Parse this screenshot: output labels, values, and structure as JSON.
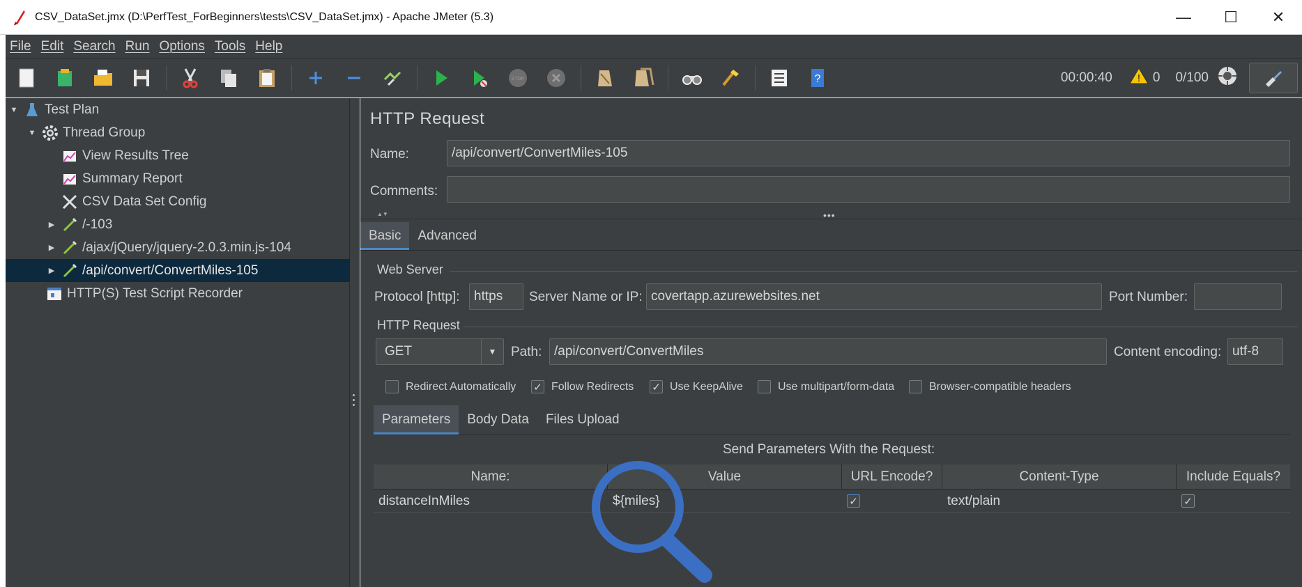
{
  "window": {
    "title": "CSV_DataSet.jmx (D:\\PerfTest_ForBeginners\\tests\\CSV_DataSet.jmx) - Apache JMeter (5.3)",
    "minimize": "—",
    "maximize": "☐",
    "close": "✕"
  },
  "menu": [
    "File",
    "Edit",
    "Search",
    "Run",
    "Options",
    "Tools",
    "Help"
  ],
  "toolbar": {
    "timer": "00:00:40",
    "warnings": "0",
    "threads": "0/100"
  },
  "tree": [
    {
      "label": "Test Plan",
      "icon": "flask-icon"
    },
    {
      "label": "Thread Group",
      "icon": "gear-icon"
    },
    {
      "label": "View Results Tree",
      "icon": "graph-icon"
    },
    {
      "label": "Summary Report",
      "icon": "graph-icon"
    },
    {
      "label": "CSV Data Set Config",
      "icon": "tools-icon"
    },
    {
      "label": "/-103",
      "icon": "pipette-icon"
    },
    {
      "label": "/ajax/jQuery/jquery-2.0.3.min.js-104",
      "icon": "pipette-icon"
    },
    {
      "label": "/api/convert/ConvertMiles-105",
      "icon": "pipette-icon"
    },
    {
      "label": "HTTP(S) Test Script Recorder",
      "icon": "recorder-icon"
    }
  ],
  "panel": {
    "title": "HTTP Request",
    "name_label": "Name:",
    "name_value": "/api/convert/ConvertMiles-105",
    "comments_label": "Comments:",
    "comments_value": "",
    "tabs": [
      "Basic",
      "Advanced"
    ],
    "web_server": {
      "legend": "Web Server",
      "protocol_label": "Protocol [http]:",
      "protocol_value": "https",
      "server_label": "Server Name or IP:",
      "server_value": "covertapp.azurewebsites.net",
      "port_label": "Port Number:",
      "port_value": ""
    },
    "http_request": {
      "legend": "HTTP Request",
      "method": "GET",
      "path_label": "Path:",
      "path_value": "/api/convert/ConvertMiles",
      "encoding_label": "Content encoding:",
      "encoding_value": "utf-8"
    },
    "options": [
      {
        "label": "Redirect Automatically",
        "checked": false
      },
      {
        "label": "Follow Redirects",
        "checked": true
      },
      {
        "label": "Use KeepAlive",
        "checked": true
      },
      {
        "label": "Use multipart/form-data",
        "checked": false
      },
      {
        "label": "Browser-compatible headers",
        "checked": false
      }
    ],
    "subtabs": [
      "Parameters",
      "Body Data",
      "Files Upload"
    ],
    "params_caption": "Send Parameters With the Request:",
    "columns": [
      "Name:",
      "Value",
      "URL Encode?",
      "Content-Type",
      "Include Equals?"
    ],
    "rows": [
      {
        "name": "distanceInMiles",
        "value": "${miles}",
        "url_encode": true,
        "content_type": "text/plain",
        "include_equals": true
      }
    ]
  },
  "check_mark": "✓",
  "colors": {
    "background": "#3c3f41",
    "selection": "#0d293e",
    "accent": "#4a88c7",
    "magnifier": "#3a6fc4"
  }
}
